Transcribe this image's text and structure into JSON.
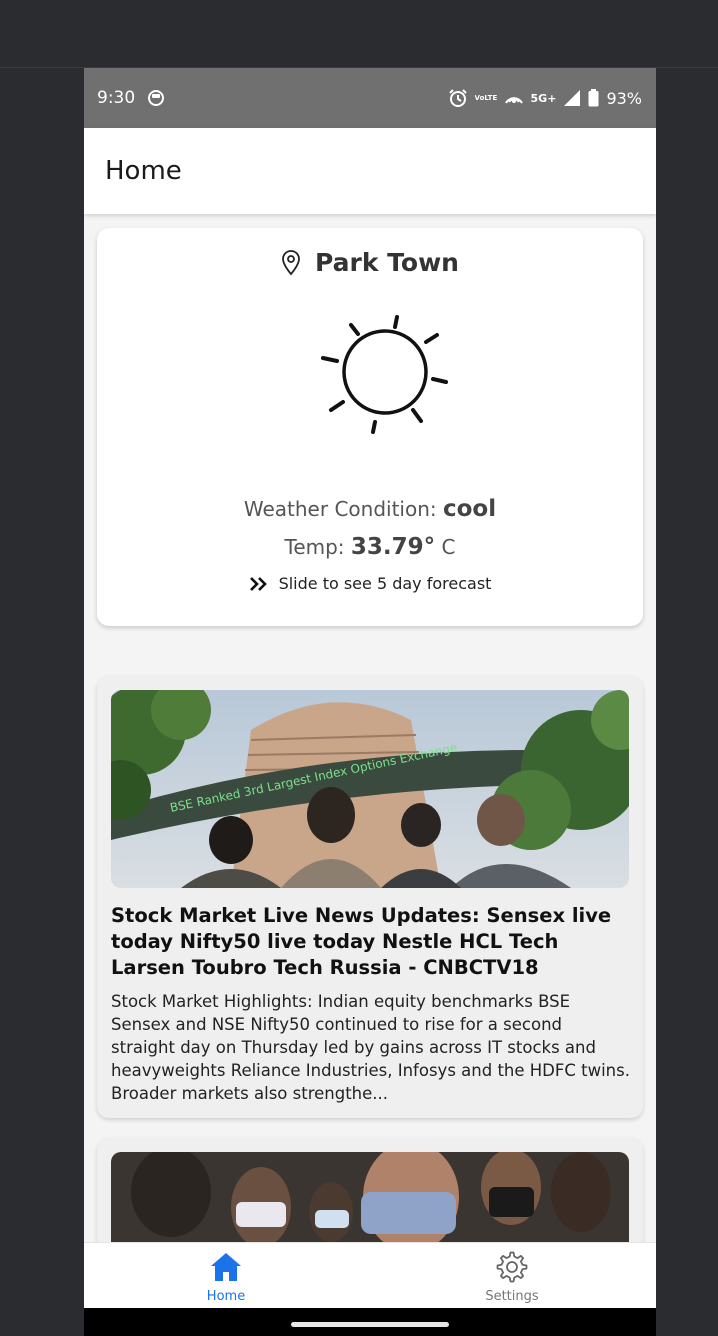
{
  "status_bar": {
    "time": "9:30",
    "battery": "93%",
    "signal_label": "5G+",
    "volte_label": "VoLTE",
    "icons": [
      "alarm-icon",
      "volte-icon",
      "hotspot-icon",
      "5g-icon",
      "signal-icon",
      "battery-icon"
    ]
  },
  "app_bar": {
    "title": "Home"
  },
  "weather": {
    "location": "Park Town",
    "condition_label": "Weather Condition: ",
    "condition_value": "cool",
    "temp_label": "Temp: ",
    "temp_value": "33.79°",
    "temp_unit": " C",
    "slide_hint": "Slide to see 5 day forecast"
  },
  "news": [
    {
      "image_desc": "BSE building with ticker",
      "ticker_text": "BSE Ranked 3rd Largest Index Options Exchange",
      "title": "Stock Market Live News Updates: Sensex live today Nifty50 live today Nestle HCL Tech Larsen Toubro Tech Russia - CNBCTV18",
      "description": "Stock Market Highlights: Indian equity benchmarks BSE Sensex and NSE Nifty50 continued to rise for a second straight day on Thursday led by gains across IT stocks and heavyweights Reliance Industries, Infosys and the HDFC twins. Broader markets also strengthe..."
    },
    {
      "image_desc": "crowd with masks"
    }
  ],
  "bottom_nav": {
    "items": [
      {
        "label": "Home",
        "icon": "home-icon",
        "active": true
      },
      {
        "label": "Settings",
        "icon": "gear-icon",
        "active": false
      }
    ]
  },
  "colors": {
    "accent": "#1a73e8",
    "status_bar": "#707070",
    "background": "#f4f4f4"
  }
}
